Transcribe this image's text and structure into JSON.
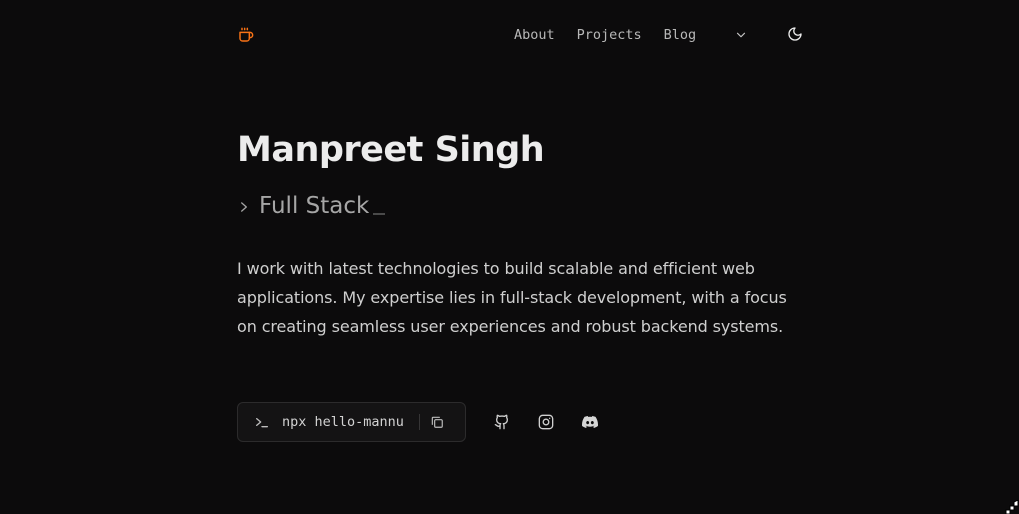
{
  "header": {
    "logo_icon": "coffee-cup-icon",
    "nav": [
      {
        "label": "About"
      },
      {
        "label": "Projects"
      },
      {
        "label": "Blog"
      }
    ],
    "dropdown_icon": "chevron-down-icon",
    "theme_icon": "moon-icon"
  },
  "hero": {
    "name": "Manpreet Singh",
    "role": "Full Stack",
    "bio": "I work with latest technologies to build scalable and efficient web applications. My expertise lies in full-stack development, with a focus on creating seamless user experiences and robust backend systems."
  },
  "command": {
    "text": "npx hello-mannu",
    "copy_icon": "copy-icon"
  },
  "socials": [
    {
      "icon": "github-icon"
    },
    {
      "icon": "instagram-icon"
    },
    {
      "icon": "discord-icon"
    }
  ],
  "colors": {
    "background": "#0c0b0c",
    "accent": "#f97316",
    "text": "#e6e6e6",
    "muted": "#b8b8b8"
  }
}
